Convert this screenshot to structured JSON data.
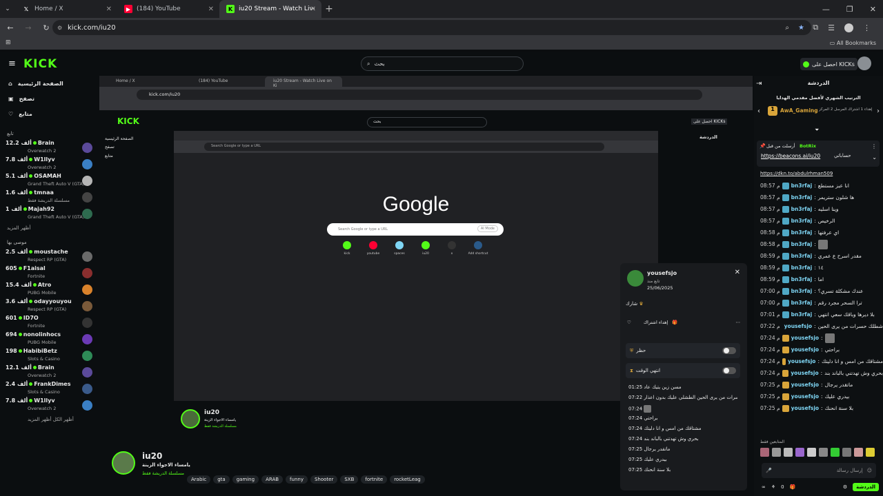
{
  "browser": {
    "tabs": [
      {
        "title": "Home / X",
        "icon": "x-logo-icon"
      },
      {
        "title": "(184) YouTube",
        "icon": "youtube-icon"
      },
      {
        "title": "iu20 Stream - Watch Live on Ki",
        "icon": "kick-icon"
      }
    ],
    "url": "kick.com/iu20",
    "bookmarks_label": "All Bookmarks"
  },
  "site": {
    "logo": "KICK",
    "search_placeholder": "بحث",
    "get_kicks": "احصل على KICKs",
    "menu": [
      {
        "label": "الصفحة الرئيسية",
        "icon": "home-icon"
      },
      {
        "label": "تصفح",
        "icon": "browse-icon"
      },
      {
        "label": "متابع",
        "icon": "heart-icon"
      }
    ],
    "following_header": "تابع",
    "following": [
      {
        "name": "Brain",
        "viewers": "12.2 ألف",
        "game": "Overwatch 2",
        "color": "#5b4a9a"
      },
      {
        "name": "W1llyv",
        "viewers": "7.8 ألف",
        "game": "Overwatch 2",
        "color": "#3a7fc4"
      },
      {
        "name": "OSAMAH",
        "viewers": "5.1 ألف",
        "game": "Grand Theft Auto V (GTA)",
        "color": "#b5b5b5"
      },
      {
        "name": "tmnaa",
        "viewers": "1.6 ألف",
        "game": "مسلسلة الدريشة فقط",
        "color": "#444444"
      },
      {
        "name": "Majah92",
        "viewers": "1 ألف",
        "game": "Grand Theft Auto V (GTA)",
        "color": "#2e6b4f"
      }
    ],
    "show_more": "أظهر المزيد",
    "recommended_header": "موصى بها",
    "recommended": [
      {
        "name": "moustache",
        "viewers": "2.5 ألف",
        "game": "Respect RP (GTA)",
        "color": "#6a6a6a"
      },
      {
        "name": "F1aisal",
        "viewers": "605",
        "game": "Fortnite",
        "color": "#8a2e2e"
      },
      {
        "name": "Atro",
        "viewers": "15.4 ألف",
        "game": "PUBG Mobile",
        "color": "#d9822b"
      },
      {
        "name": "odayyouyou",
        "viewers": "3.6 ألف",
        "game": "Respect RP (GTA)",
        "color": "#7a5a3a"
      },
      {
        "name": "ID7O",
        "viewers": "601",
        "game": "Fortnite",
        "color": "#333333"
      },
      {
        "name": "nonolinhocs",
        "viewers": "694",
        "game": "PUBG Mobile",
        "color": "#6b3ab5"
      },
      {
        "name": "HabibiBetz",
        "viewers": "198",
        "game": "Slots & Casino",
        "color": "#2e8b57"
      },
      {
        "name": "Brain",
        "viewers": "12.1 ألف",
        "game": "Overwatch 2",
        "color": "#5b4a9a"
      },
      {
        "name": "FrankDimes",
        "viewers": "2.4 ألف",
        "game": "Slots & Casino",
        "color": "#3a5a8a"
      },
      {
        "name": "W1llyv",
        "viewers": "7.8 ألف",
        "game": "Overwatch 2",
        "color": "#3a7fc4"
      }
    ],
    "show_all": "أظهر الكل"
  },
  "inner_google": {
    "logo": "Google",
    "search_placeholder": "Search Google or type a URL",
    "ai_mode": "AI Mode",
    "shortcuts": [
      "kick",
      "youtube",
      "spaces",
      "iu20",
      "x",
      "Add shortcut"
    ]
  },
  "stream": {
    "name": "iu20",
    "title": "يامساء الاجواء الزينة",
    "category": "مسلسلة الدريشة فقط",
    "tags": [
      "Arabic",
      "gta",
      "gaming",
      "ARAB",
      "funny",
      "Shooter",
      "SXB",
      "fortnite",
      "rocketLeag"
    ]
  },
  "chat": {
    "title": "الدردشة",
    "leaderboard_title": "الترتيب الشهري لأفضل مقدمي الهدايا",
    "top_gifter": "AwA_Gaming",
    "top_gifter_note": "إهداء 1 اشتراك المرسل 2 المركز",
    "pinned_by": "أرسلت من قبل",
    "pinned_user": "BotRix",
    "pinned_link": "https://beacons.ai/iu20",
    "pinned_text": "حساباتي",
    "faded_link": "https://dkn.to/abdulrhman509",
    "messages": [
      {
        "time": "08:57 م",
        "user": "bn3rfaj",
        "text": "انا عبز مستطع",
        "color": "blue"
      },
      {
        "time": "08:57 م",
        "user": "bn3rfaj",
        "text": "ها شلون ستريمر",
        "color": "blue"
      },
      {
        "time": "08:57 م",
        "user": "bn3rfaj",
        "text": "وينا اسليه",
        "color": "blue"
      },
      {
        "time": "08:57 م",
        "user": "bn3rfaj",
        "text": "الرخيص",
        "color": "blue"
      },
      {
        "time": "08:58 م",
        "user": "bn3rfaj",
        "text": "اي عرفتها",
        "color": "blue"
      },
      {
        "time": "08:58 م",
        "user": "bn3rfaj",
        "text": "",
        "color": "blue"
      },
      {
        "time": "08:59 م",
        "user": "bn3rfaj",
        "text": "مقدر اسرح ع عمري",
        "color": "blue"
      },
      {
        "time": "08:59 م",
        "user": "bn3rfaj",
        "text": "١٤",
        "color": "blue"
      },
      {
        "time": "08:59 م",
        "user": "bn3rfaj",
        "text": "اما",
        "color": "blue"
      },
      {
        "time": "07:00 م",
        "user": "bn3rfaj",
        "text": "عندك مشكلة تسري؟",
        "color": "blue"
      },
      {
        "time": "07:00 م",
        "user": "bn3rfaj",
        "text": "ترا السحر مجرد رقم",
        "color": "blue"
      },
      {
        "time": "07:01 م",
        "user": "bn3rfaj",
        "text": "بلا ديرها وباقك سعي انتهي",
        "color": "blue"
      },
      {
        "time": "07:22 م",
        "user": "yousefsjo",
        "text": "اخيرا شطلك حسرات من يرى الحين",
        "color": "gold"
      },
      {
        "time": "07:24 م",
        "user": "yousefsjo",
        "text": "",
        "color": "gold"
      },
      {
        "time": "07:24 م",
        "user": "yousefsjo",
        "text": "براحتي",
        "color": "gold"
      },
      {
        "time": "07:24 م",
        "user": "yousefsjo",
        "text": "مشتاقك من امس و انا دليتك",
        "color": "gold"
      },
      {
        "time": "07:24 م",
        "user": "yousefsjo",
        "text": "بحري وش تهدتني بالباند بند",
        "color": "gold"
      },
      {
        "time": "07:25 م",
        "user": "yousefsjo",
        "text": "ماتقدر يرجال",
        "color": "gold"
      },
      {
        "time": "07:25 م",
        "user": "yousefsjo",
        "text": "بيدري عليك",
        "color": "gold"
      },
      {
        "time": "07:25 م",
        "user": "yousefsjo",
        "text": "بلا سنة انحنك",
        "color": "gold"
      }
    ],
    "supporters_label": "المتابعين فقط",
    "input_placeholder": "إرسال رسالة",
    "send_label": "الدردشة",
    "count": "0"
  },
  "popup": {
    "username": "yousefsjo",
    "followed_label": "تابع منذ",
    "followed_date": "25/06/2025",
    "subscribed_label": "شارك",
    "gift_label": "إهداء اشتراك",
    "ban_label": "حظر",
    "timeout_label": "انتهي الوقت",
    "history": [
      {
        "time": "01:25",
        "text": "مسن زين يتيك عاد"
      },
      {
        "time": "07:22",
        "text": "ماخذيرا شطلك حسرات من يرى الحين الطشلي عليك بدون اعذار"
      },
      {
        "time": "07:24",
        "text": ""
      },
      {
        "time": "07:24",
        "text": "براحتي"
      },
      {
        "time": "07:24",
        "text": "مشتاقك من امس و انا دليتك"
      },
      {
        "time": "07:24",
        "text": "بحري وش تهدتني بالباند بند"
      },
      {
        "time": "07:25",
        "text": "ماتقدر يرجال"
      },
      {
        "time": "07:25",
        "text": "بيدري عليك"
      },
      {
        "time": "07:25",
        "text": "بلا سنة انحنك"
      }
    ]
  }
}
